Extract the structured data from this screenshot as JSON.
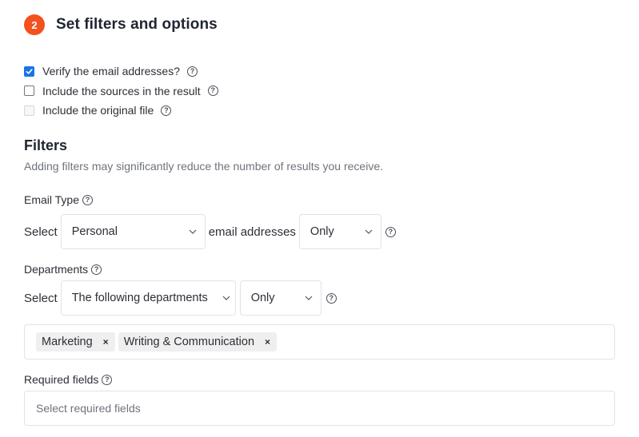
{
  "step": {
    "number": "2",
    "title": "Set filters and options",
    "accent_color": "#f4511e"
  },
  "options": [
    {
      "label": "Verify the email addresses?",
      "checked": true,
      "disabled": false
    },
    {
      "label": "Include the sources in the result",
      "checked": false,
      "disabled": false
    },
    {
      "label": "Include the original file",
      "checked": false,
      "disabled": true
    }
  ],
  "help_glyph": "?",
  "filters": {
    "title": "Filters",
    "subtitle": "Adding filters may significantly reduce the number of results you receive.",
    "email_type": {
      "label": "Email Type",
      "prefix": "Select",
      "type_value": "Personal",
      "middle_text": "email addresses",
      "mode_value": "Only"
    },
    "departments": {
      "label": "Departments",
      "prefix": "Select",
      "dept_value": "The following departments",
      "mode_value": "Only",
      "tags": [
        {
          "label": "Marketing",
          "remove": "×"
        },
        {
          "label": "Writing & Communication",
          "remove": "×"
        }
      ]
    },
    "required_fields": {
      "label": "Required fields",
      "placeholder": "Select required fields"
    }
  }
}
